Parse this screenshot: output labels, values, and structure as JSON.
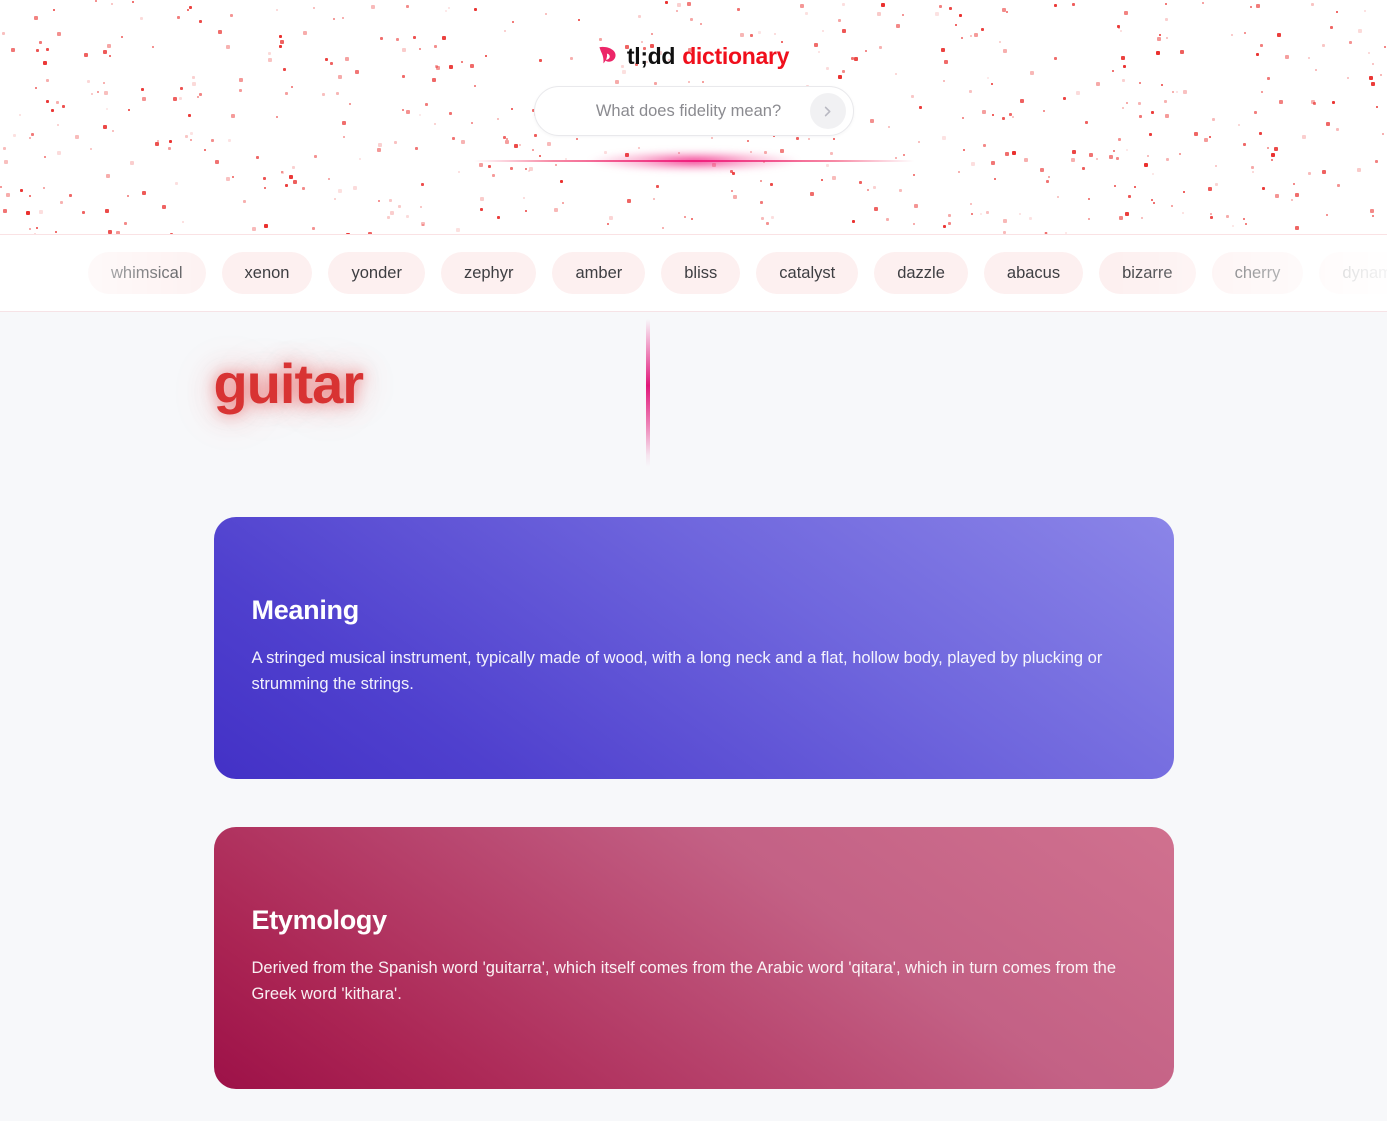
{
  "brand": {
    "mark_icon": "bird-icon",
    "name_primary": "tl;dd",
    "name_accent": "dictionary",
    "accent_color": "#f00f1c",
    "mark_color": "#ec2668"
  },
  "search": {
    "placeholder": "What does fidelity mean?",
    "value": "",
    "submit_icon": "chevron-right-icon",
    "submit_label": "Search"
  },
  "chips": {
    "items": [
      {
        "label": "whimsical"
      },
      {
        "label": "xenon"
      },
      {
        "label": "yonder"
      },
      {
        "label": "zephyr"
      },
      {
        "label": "amber"
      },
      {
        "label": "bliss"
      },
      {
        "label": "catalyst"
      },
      {
        "label": "dazzle"
      },
      {
        "label": "abacus"
      },
      {
        "label": "bizarre"
      },
      {
        "label": "cherry"
      },
      {
        "label": "dynamic"
      }
    ]
  },
  "entry": {
    "word": "guitar",
    "word_color": "#d83333",
    "cards": [
      {
        "title": "Meaning",
        "body": "A stringed musical instrument, typically made of wood, with a long neck and a flat, hollow body, played by plucking or strumming the strings.",
        "accent_color": "#5244d4"
      },
      {
        "title": "Etymology",
        "body": "Derived from the Spanish word 'guitarra', which itself comes from the Arabic word 'qitara', which in turn comes from the Greek word 'kithara'.",
        "accent_color": "#ab2554"
      }
    ]
  }
}
